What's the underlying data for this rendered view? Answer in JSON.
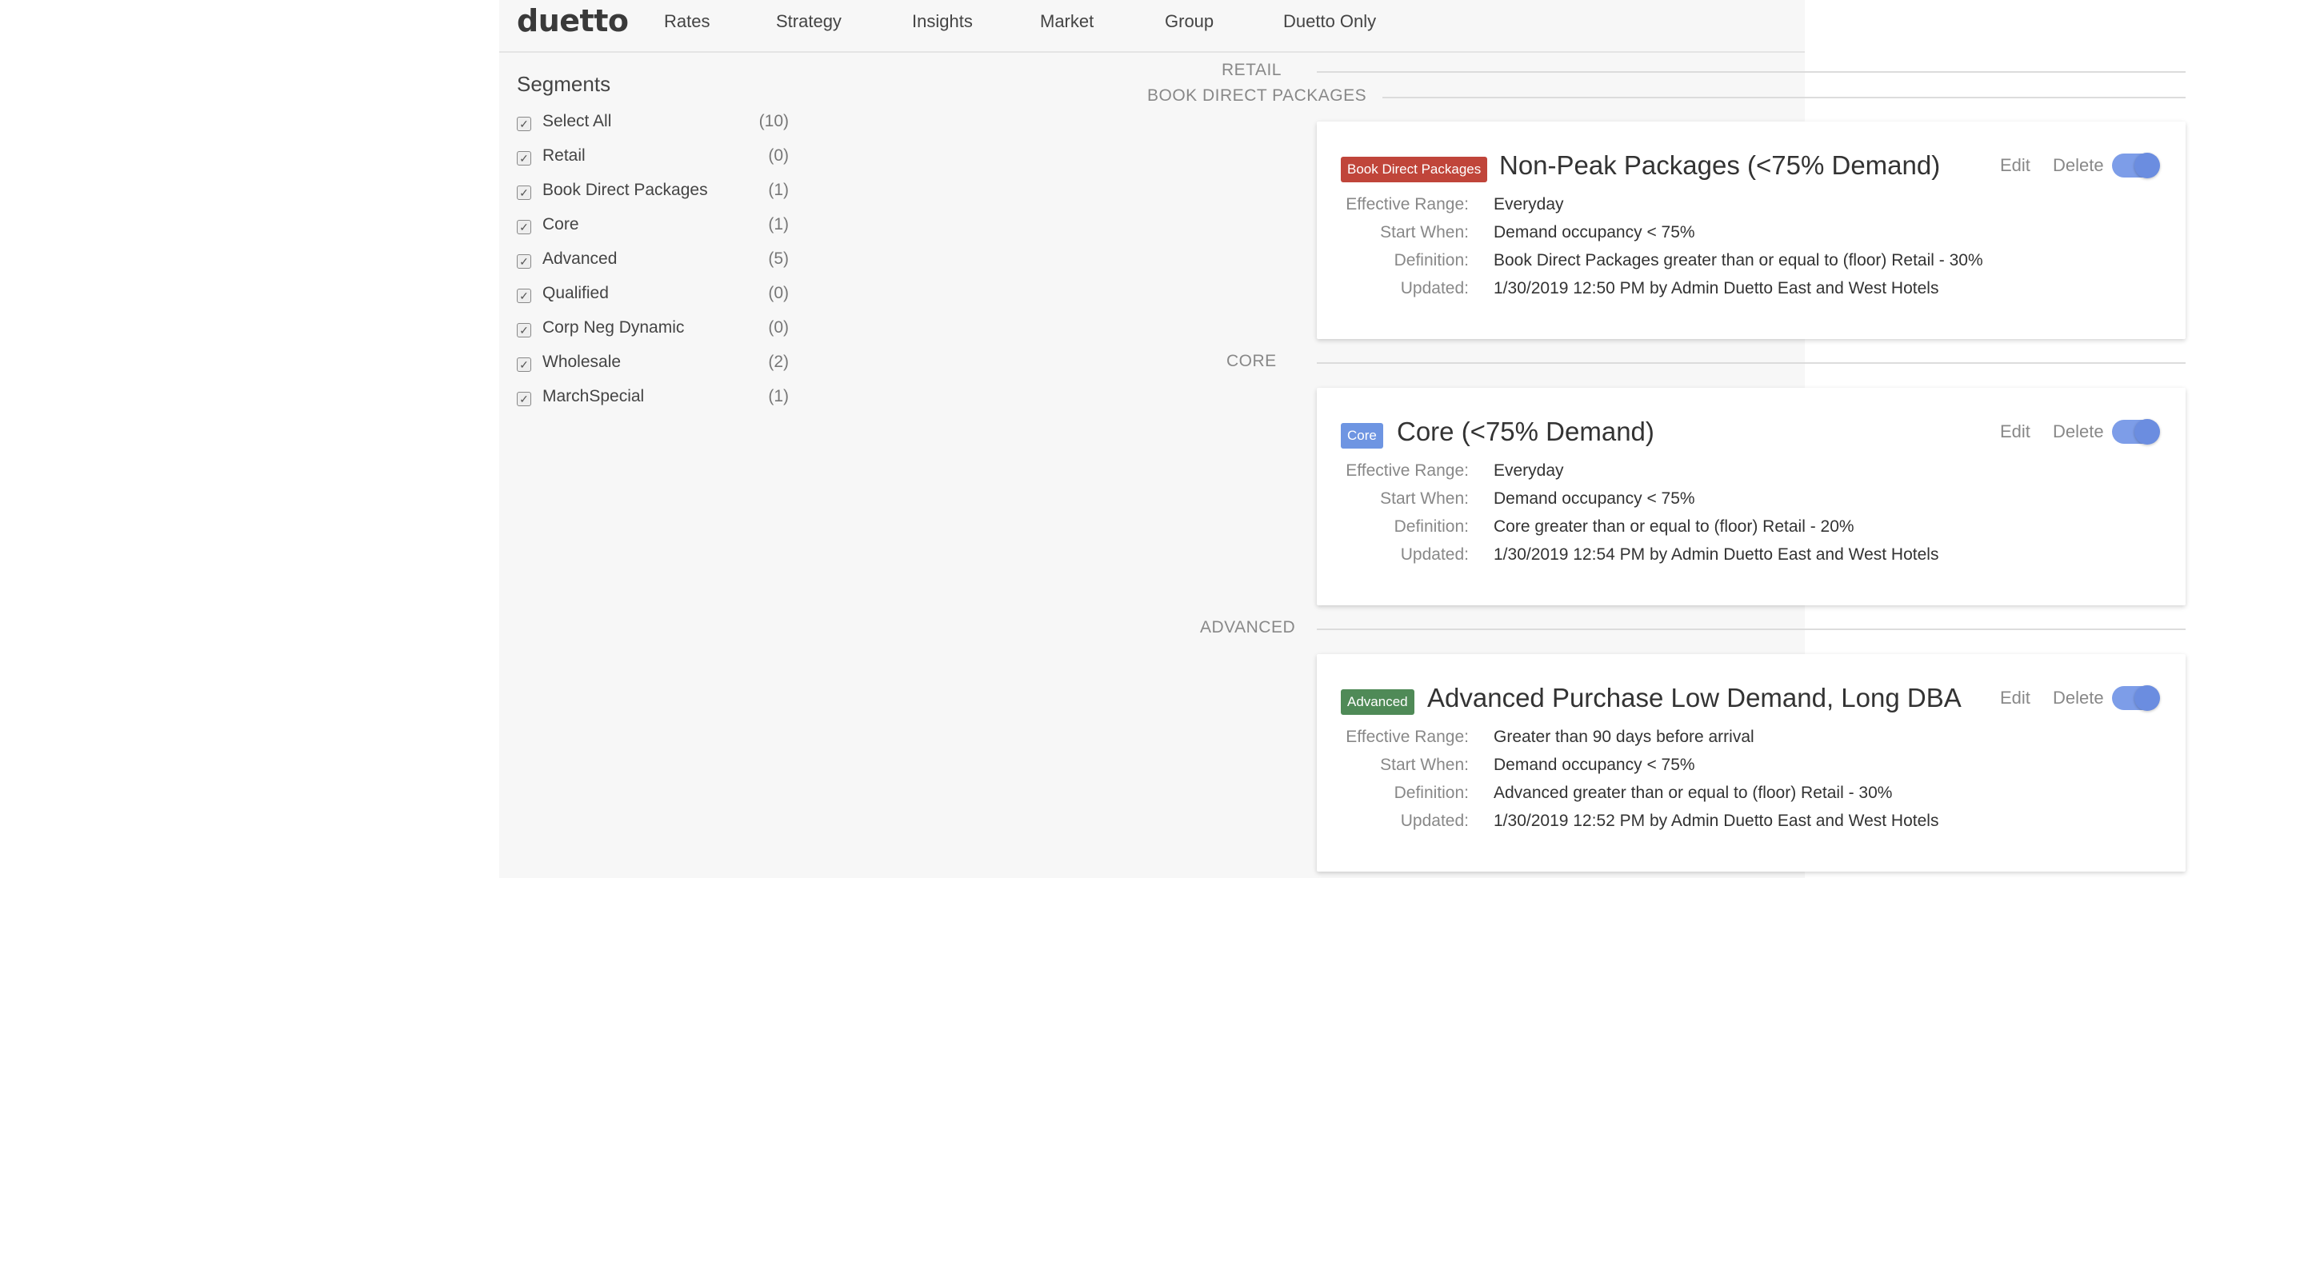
{
  "app": {
    "logo": "duetto",
    "nav": [
      "Rates",
      "Strategy",
      "Insights",
      "Market",
      "Group",
      "Duetto Only"
    ]
  },
  "sidebar": {
    "title": "Segments",
    "items": [
      {
        "label": "Select All",
        "count": "(10)"
      },
      {
        "label": "Retail",
        "count": "(0)"
      },
      {
        "label": "Book Direct Packages",
        "count": "(1)"
      },
      {
        "label": "Core",
        "count": "(1)"
      },
      {
        "label": "Advanced",
        "count": "(5)"
      },
      {
        "label": "Qualified",
        "count": "(0)"
      },
      {
        "label": "Corp Neg Dynamic",
        "count": "(0)"
      },
      {
        "label": "Wholesale",
        "count": "(2)"
      },
      {
        "label": "MarchSpecial",
        "count": "(1)"
      }
    ]
  },
  "sections": {
    "retail": "RETAIL",
    "book_direct": "BOOK DIRECT PACKAGES",
    "core": "CORE",
    "advanced": "ADVANCED"
  },
  "labels": {
    "effective_range": "Effective Range:",
    "start_when": "Start When:",
    "definition": "Definition:",
    "updated": "Updated:",
    "edit": "Edit",
    "delete": "Delete"
  },
  "cards": [
    {
      "badge": "Book Direct Packages",
      "badge_color": "#c0453a",
      "title": "Non-Peak Packages (<75% Demand)",
      "effective_range": "Everyday",
      "start_when": "Demand occupancy < 75%",
      "definition": "Book Direct Packages greater than or equal to (floor) Retail - 30%",
      "updated": "1/30/2019 12:50 PM by Admin Duetto East and West Hotels"
    },
    {
      "badge": "Core",
      "badge_color": "#6e95e2",
      "title": "Core (<75% Demand)",
      "effective_range": "Everyday",
      "start_when": "Demand occupancy < 75%",
      "definition": "Core greater than or equal to (floor) Retail - 20%",
      "updated": "1/30/2019 12:54 PM by Admin Duetto East and West Hotels"
    },
    {
      "badge": "Advanced",
      "badge_color": "#4f8a57",
      "title": "Advanced Purchase Low Demand, Long DBA",
      "effective_range": "Greater than 90 days before arrival",
      "start_when": "Demand occupancy < 75%",
      "definition": "Advanced greater than or equal to (floor) Retail - 30%",
      "updated": "1/30/2019 12:52 PM by Admin Duetto East and West Hotels"
    }
  ]
}
